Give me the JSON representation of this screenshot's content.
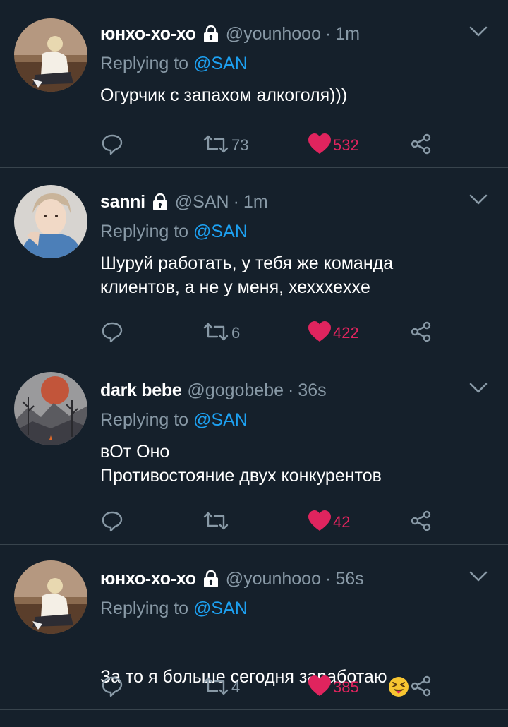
{
  "tweets": [
    {
      "name": "юнхо-хо-хо",
      "handle": "@younhooo",
      "dot": "·",
      "time": "1m",
      "reply_prefix": "Replying to ",
      "reply_to": "@SAN",
      "text": "Огурчик с запахом алкоголя)))",
      "retweets": "73",
      "likes": "532",
      "protected": true,
      "avatar": "person-sitting-avatar"
    },
    {
      "name": "sanni",
      "handle": "@SAN",
      "dot": "·",
      "time": "1m",
      "reply_prefix": "Replying to ",
      "reply_to": "@SAN",
      "text": "Шуруй работать, у тебя же команда\nклиентов, а не у меня, хеххxexxe",
      "retweets": "6",
      "likes": "422",
      "protected": true,
      "avatar": "person-portrait-avatar"
    },
    {
      "name": "dark bebe",
      "handle": "@gogobebe",
      "dot": "·",
      "time": "36s",
      "reply_prefix": "Replying to ",
      "reply_to": "@SAN",
      "text": "вОт Оно\nПротивостояние двух конкурентов",
      "retweets": "",
      "likes": "42",
      "protected": false,
      "avatar": "forest-moon-avatar"
    },
    {
      "name": "юнхо-хо-хо",
      "handle": "@younhooo",
      "dot": "·",
      "time": "56s",
      "reply_prefix": "Replying to ",
      "reply_to": "@SAN",
      "text": "За то я больше сегодня заработаю",
      "retweets": "4",
      "likes": "385",
      "protected": true,
      "avatar": "person-sitting-avatar",
      "emoji": "squinting-tongue-face-emoji"
    }
  ],
  "colors": {
    "background": "#15202b",
    "divider": "#38444d",
    "secondary_text": "#8899a6",
    "mention": "#1da1f2",
    "like": "#e0245e"
  }
}
